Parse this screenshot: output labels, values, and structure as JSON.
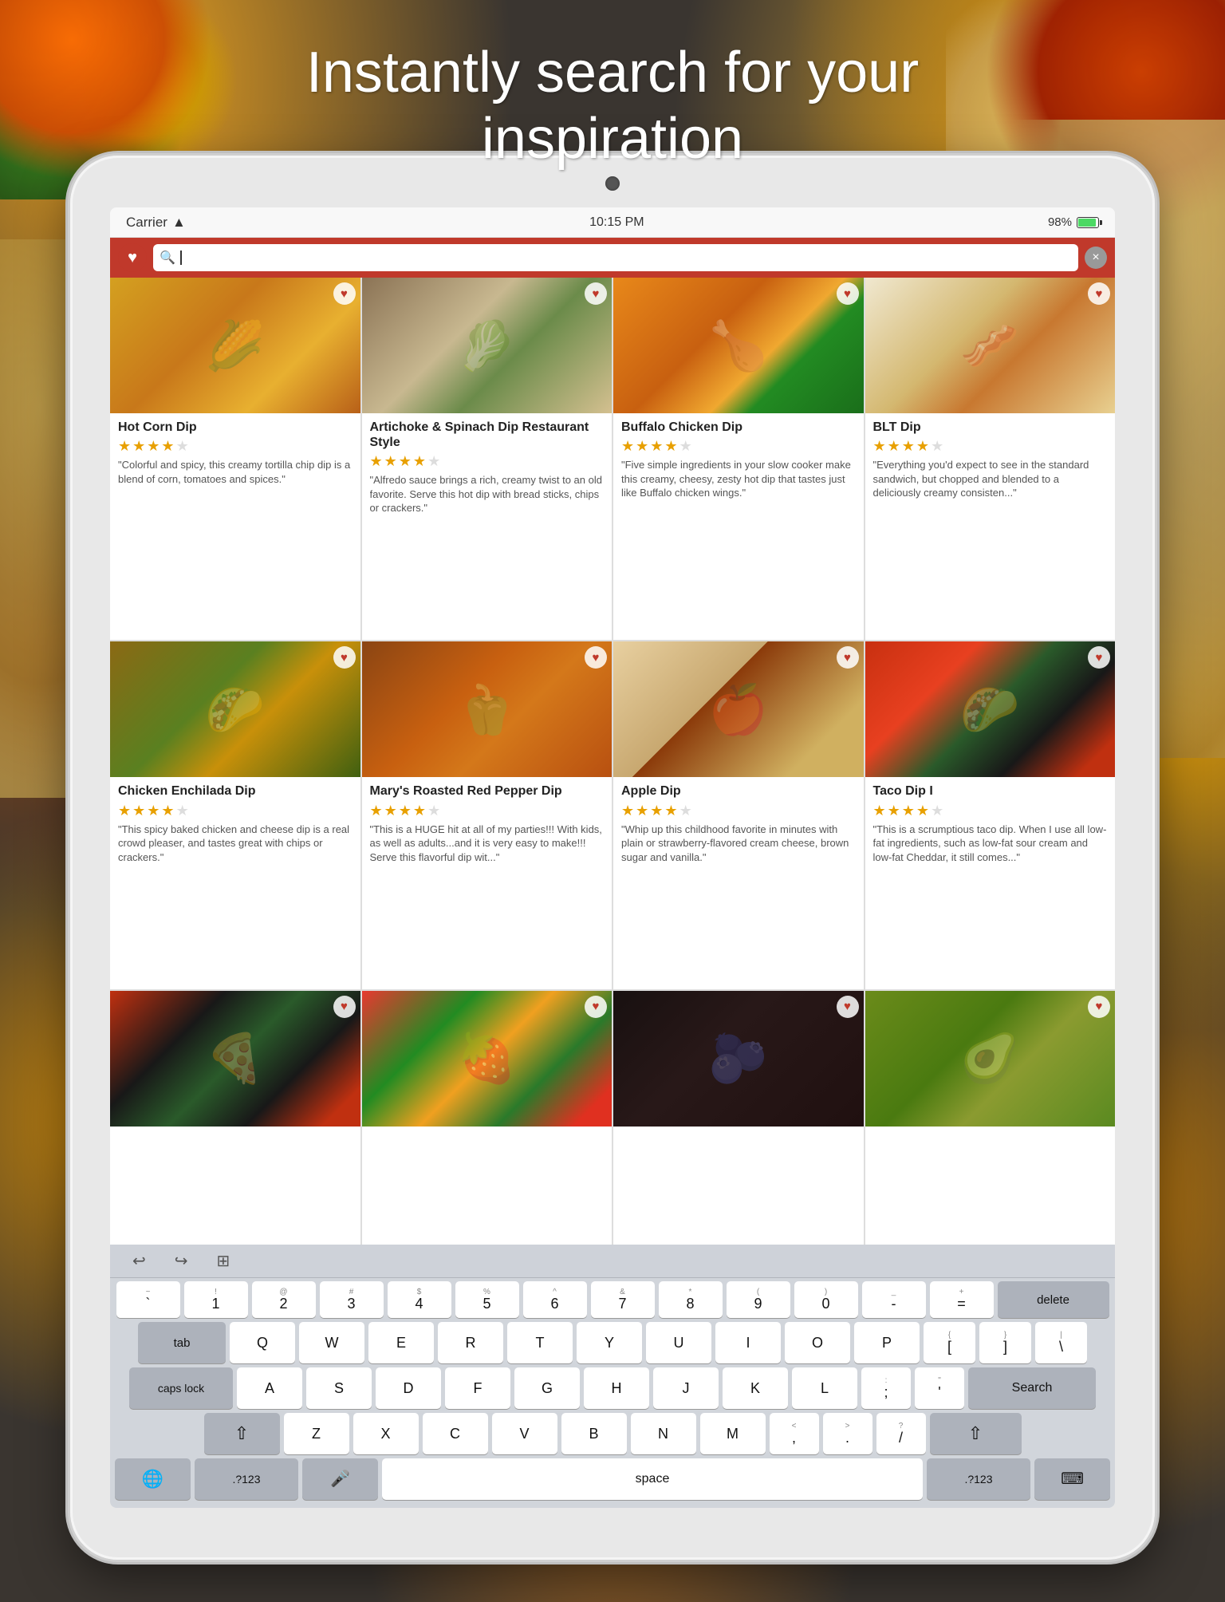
{
  "headline": {
    "line1": "Instantly search for your",
    "line2": "inspiration"
  },
  "status_bar": {
    "carrier": "Carrier",
    "wifi_icon": "wifi",
    "time": "10:15 PM",
    "battery_pct": "98%"
  },
  "search_bar": {
    "placeholder": "",
    "clear_label": "×"
  },
  "recipes": [
    {
      "id": 1,
      "title": "Hot Corn Dip",
      "stars": 4,
      "description": "\"Colorful and spicy, this creamy tortilla chip dip is a blend of corn, tomatoes and spices.\"",
      "img_class": "img-hot-corn",
      "emoji": "🌽"
    },
    {
      "id": 2,
      "title": "Artichoke & Spinach Dip Restaurant Style",
      "stars": 4,
      "description": "\"Alfredo sauce brings a rich, creamy twist to an old favorite. Serve this hot dip with bread sticks, chips or crackers.\"",
      "img_class": "img-artichoke",
      "emoji": "🥬"
    },
    {
      "id": 3,
      "title": "Buffalo Chicken Dip",
      "stars": 4,
      "description": "\"Five simple ingredients in your slow cooker make this creamy, cheesy, zesty hot dip that tastes just like Buffalo chicken wings.\"",
      "img_class": "img-buffalo",
      "emoji": "🍗"
    },
    {
      "id": 4,
      "title": "BLT Dip",
      "stars": 4,
      "description": "\"Everything you'd expect to see in the standard sandwich, but chopped and blended to a deliciously creamy consisten...\"",
      "img_class": "img-blt",
      "emoji": "🥓"
    },
    {
      "id": 5,
      "title": "Chicken Enchilada Dip",
      "stars": 4,
      "description": "\"This spicy baked chicken and cheese dip is a real crowd pleaser, and tastes great with chips or crackers.\"",
      "img_class": "img-chicken",
      "emoji": "🌮"
    },
    {
      "id": 6,
      "title": "Mary's Roasted Red Pepper Dip",
      "stars": 4,
      "description": "\"This is a HUGE hit at all of my parties!!! With kids, as well as adults...and it is very easy to make!!! Serve this flavorful dip wit...\"",
      "img_class": "img-roasted",
      "emoji": "🫑"
    },
    {
      "id": 7,
      "title": "Apple Dip",
      "stars": 4,
      "description": "\"Whip up this childhood favorite in minutes with plain or strawberry-flavored cream cheese, brown sugar and vanilla.\"",
      "img_class": "img-apple",
      "emoji": "🍎"
    },
    {
      "id": 8,
      "title": "Taco Dip I",
      "stars": 4,
      "description": "\"This is a scrumptious taco dip. When I use all low-fat ingredients, such as low-fat sour cream and low-fat Cheddar, it still comes...\"",
      "img_class": "img-taco",
      "emoji": "🌮"
    },
    {
      "id": 9,
      "title": "",
      "stars": 0,
      "description": "",
      "img_class": "img-pizza1",
      "emoji": "🍕"
    },
    {
      "id": 10,
      "title": "",
      "stars": 0,
      "description": "",
      "img_class": "img-fruit",
      "emoji": "🍓"
    },
    {
      "id": 11,
      "title": "",
      "stars": 0,
      "description": "",
      "img_class": "img-dark",
      "emoji": "🫐"
    },
    {
      "id": 12,
      "title": "",
      "stars": 0,
      "description": "",
      "img_class": "img-guac",
      "emoji": "🥑"
    }
  ],
  "keyboard": {
    "toolbar": {
      "undo": "↩",
      "redo": "↪",
      "paste": "⊞"
    },
    "num_row": [
      {
        "secondary": "~",
        "primary": "`",
        "secondary2": "1"
      },
      {
        "secondary": "!",
        "primary": "1"
      },
      {
        "secondary": "@",
        "primary": "2"
      },
      {
        "secondary": "#",
        "primary": "3"
      },
      {
        "secondary": "$",
        "primary": "4"
      },
      {
        "secondary": "%",
        "primary": "5"
      },
      {
        "secondary": "^",
        "primary": "6"
      },
      {
        "secondary": "&",
        "primary": "7"
      },
      {
        "secondary": "*",
        "primary": "8"
      },
      {
        "secondary": "(",
        "primary": "9"
      },
      {
        "secondary": ")",
        "primary": "0"
      },
      {
        "secondary": "_",
        "primary": "-"
      },
      {
        "secondary": "+",
        "primary": "="
      },
      {
        "primary": "delete",
        "wide": true
      }
    ],
    "row1": {
      "special": "tab",
      "keys": [
        "Q",
        "W",
        "E",
        "R",
        "T",
        "Y",
        "U",
        "I",
        "O",
        "P"
      ],
      "end": [
        "{[",
        "}]",
        "|\\"
      ]
    },
    "row2": {
      "special": "caps lock",
      "keys": [
        "A",
        "S",
        "D",
        "F",
        "G",
        "H",
        "J",
        "K",
        "L"
      ],
      "end": [
        ":;",
        "\"'"
      ],
      "action": "Search"
    },
    "row3": {
      "special": "shift",
      "keys": [
        "Z",
        "X",
        "C",
        "V",
        "B",
        "N",
        "M"
      ],
      "end": [
        "<,",
        ">.",
        "?/"
      ],
      "action": "shift"
    },
    "bottom": {
      "globe": "🌐",
      "num1": ".?123",
      "mic": "🎤",
      "space": "space",
      "num2": ".?123",
      "hide": "⌨"
    }
  }
}
